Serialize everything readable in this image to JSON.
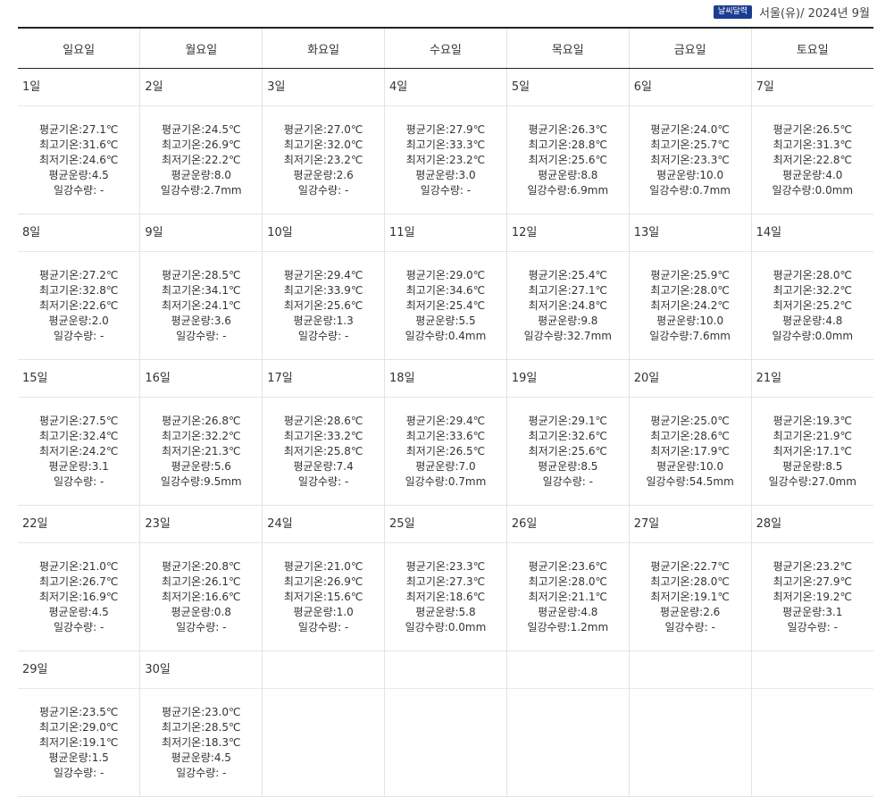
{
  "header": {
    "badge": "날씨달력",
    "location": "서울(유)/ 2024년 9월"
  },
  "weekdays": [
    "일요일",
    "월요일",
    "화요일",
    "수요일",
    "목요일",
    "금요일",
    "토요일"
  ],
  "labels": {
    "avg": "평균기온:",
    "max": "최고기온:",
    "min": "최저기온:",
    "cloud": "평균운량:",
    "rain": "일강수량:"
  },
  "weeks": [
    [
      {
        "day": "1일",
        "avg": "27.1℃",
        "max": "31.6℃",
        "min": "24.6℃",
        "cloud": "4.5",
        "rain": " -"
      },
      {
        "day": "2일",
        "avg": "24.5℃",
        "max": "26.9℃",
        "min": "22.2℃",
        "cloud": "8.0",
        "rain": "2.7mm"
      },
      {
        "day": "3일",
        "avg": "27.0℃",
        "max": "32.0℃",
        "min": "23.2℃",
        "cloud": "2.6",
        "rain": " -"
      },
      {
        "day": "4일",
        "avg": "27.9℃",
        "max": "33.3℃",
        "min": "23.2℃",
        "cloud": "3.0",
        "rain": " -"
      },
      {
        "day": "5일",
        "avg": "26.3℃",
        "max": "28.8℃",
        "min": "25.6℃",
        "cloud": "8.8",
        "rain": "6.9mm"
      },
      {
        "day": "6일",
        "avg": "24.0℃",
        "max": "25.7℃",
        "min": "23.3℃",
        "cloud": "10.0",
        "rain": "0.7mm"
      },
      {
        "day": "7일",
        "avg": "26.5℃",
        "max": "31.3℃",
        "min": "22.8℃",
        "cloud": "4.0",
        "rain": "0.0mm"
      }
    ],
    [
      {
        "day": "8일",
        "avg": "27.2℃",
        "max": "32.8℃",
        "min": "22.6℃",
        "cloud": "2.0",
        "rain": " -"
      },
      {
        "day": "9일",
        "avg": "28.5℃",
        "max": "34.1℃",
        "min": "24.1℃",
        "cloud": "3.6",
        "rain": " -"
      },
      {
        "day": "10일",
        "avg": "29.4℃",
        "max": "33.9℃",
        "min": "25.6℃",
        "cloud": "1.3",
        "rain": " -"
      },
      {
        "day": "11일",
        "avg": "29.0℃",
        "max": "34.6℃",
        "min": "25.4℃",
        "cloud": "5.5",
        "rain": "0.4mm"
      },
      {
        "day": "12일",
        "avg": "25.4℃",
        "max": "27.1℃",
        "min": "24.8℃",
        "cloud": "9.8",
        "rain": "32.7mm"
      },
      {
        "day": "13일",
        "avg": "25.9℃",
        "max": "28.0℃",
        "min": "24.2℃",
        "cloud": "10.0",
        "rain": "7.6mm"
      },
      {
        "day": "14일",
        "avg": "28.0℃",
        "max": "32.2℃",
        "min": "25.2℃",
        "cloud": "4.8",
        "rain": "0.0mm"
      }
    ],
    [
      {
        "day": "15일",
        "avg": "27.5℃",
        "max": "32.4℃",
        "min": "24.2℃",
        "cloud": "3.1",
        "rain": " -"
      },
      {
        "day": "16일",
        "avg": "26.8℃",
        "max": "32.2℃",
        "min": "21.3℃",
        "cloud": "5.6",
        "rain": "9.5mm"
      },
      {
        "day": "17일",
        "avg": "28.6℃",
        "max": "33.2℃",
        "min": "25.8℃",
        "cloud": "7.4",
        "rain": " -"
      },
      {
        "day": "18일",
        "avg": "29.4℃",
        "max": "33.6℃",
        "min": "26.5℃",
        "cloud": "7.0",
        "rain": "0.7mm"
      },
      {
        "day": "19일",
        "avg": "29.1℃",
        "max": "32.6℃",
        "min": "25.6℃",
        "cloud": "8.5",
        "rain": " -"
      },
      {
        "day": "20일",
        "avg": "25.0℃",
        "max": "28.6℃",
        "min": "17.9℃",
        "cloud": "10.0",
        "rain": "54.5mm"
      },
      {
        "day": "21일",
        "avg": "19.3℃",
        "max": "21.9℃",
        "min": "17.1℃",
        "cloud": "8.5",
        "rain": "27.0mm"
      }
    ],
    [
      {
        "day": "22일",
        "avg": "21.0℃",
        "max": "26.7℃",
        "min": "16.9℃",
        "cloud": "4.5",
        "rain": " -"
      },
      {
        "day": "23일",
        "avg": "20.8℃",
        "max": "26.1℃",
        "min": "16.6℃",
        "cloud": "0.8",
        "rain": " -"
      },
      {
        "day": "24일",
        "avg": "21.0℃",
        "max": "26.9℃",
        "min": "15.6℃",
        "cloud": "1.0",
        "rain": " -"
      },
      {
        "day": "25일",
        "avg": "23.3℃",
        "max": "27.3℃",
        "min": "18.6℃",
        "cloud": "5.8",
        "rain": "0.0mm"
      },
      {
        "day": "26일",
        "avg": "23.6℃",
        "max": "28.0℃",
        "min": "21.1℃",
        "cloud": "4.8",
        "rain": "1.2mm"
      },
      {
        "day": "27일",
        "avg": "22.7℃",
        "max": "28.0℃",
        "min": "19.1℃",
        "cloud": "2.6",
        "rain": " -"
      },
      {
        "day": "28일",
        "avg": "23.2℃",
        "max": "27.9℃",
        "min": "19.2℃",
        "cloud": "3.1",
        "rain": " -"
      }
    ],
    [
      {
        "day": "29일",
        "avg": "23.5℃",
        "max": "29.0℃",
        "min": "19.1℃",
        "cloud": "1.5",
        "rain": " -"
      },
      {
        "day": "30일",
        "avg": "23.0℃",
        "max": "28.5℃",
        "min": "18.3℃",
        "cloud": "4.5",
        "rain": " -"
      },
      null,
      null,
      null,
      null,
      null
    ]
  ]
}
